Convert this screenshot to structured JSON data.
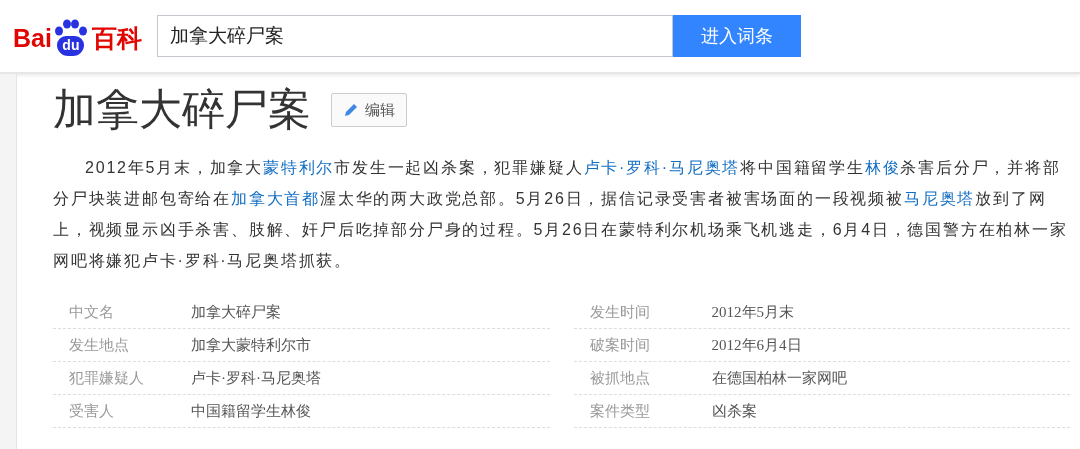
{
  "logo": {
    "parts": [
      "Bai",
      "du",
      "百科"
    ]
  },
  "search": {
    "value": "加拿大碎尸案",
    "button": "进入词条"
  },
  "title": "加拿大碎尸案",
  "edit_button": "编辑",
  "summary": [
    {
      "kind": "text",
      "text": "2012年5月末，加拿大"
    },
    {
      "kind": "link",
      "text": "蒙特利尔"
    },
    {
      "kind": "text",
      "text": "市发生一起凶杀案，犯罪嫌疑人"
    },
    {
      "kind": "link",
      "text": "卢卡·罗科·马尼奥塔"
    },
    {
      "kind": "text",
      "text": "将中国籍留学生"
    },
    {
      "kind": "link",
      "text": "林俊"
    },
    {
      "kind": "text",
      "text": "杀害后分尸，并将部分尸块装进邮包寄给在"
    },
    {
      "kind": "link",
      "text": "加拿大首都"
    },
    {
      "kind": "text",
      "text": "渥太华的两大政党总部。5月26日，据信记录受害者被害场面的一段视频被"
    },
    {
      "kind": "link",
      "text": "马尼奥塔"
    },
    {
      "kind": "text",
      "text": "放到了网上，视频显示凶手杀害、肢解、奸尸后吃掉部分尸身的过程。5月26日在蒙特利尔机场乘飞机逃走，6月4日，德国警方在柏林一家网吧将嫌犯卢卡·罗科·马尼奥塔抓获。"
    }
  ],
  "basic_info": [
    {
      "name": "中文名",
      "value": "加拿大碎尸案"
    },
    {
      "name": "发生时间",
      "value": "2012年5月末"
    },
    {
      "name": "发生地点",
      "value": "加拿大蒙特利尔市"
    },
    {
      "name": "破案时间",
      "value": "2012年6月4日"
    },
    {
      "name": "犯罪嫌疑人",
      "value": "卢卡·罗科·马尼奥塔"
    },
    {
      "name": "被抓地点",
      "value": "在德国柏林一家网吧"
    },
    {
      "name": "受害人",
      "value": "中国籍留学生林俊"
    },
    {
      "name": "案件类型",
      "value": "凶杀案"
    }
  ]
}
